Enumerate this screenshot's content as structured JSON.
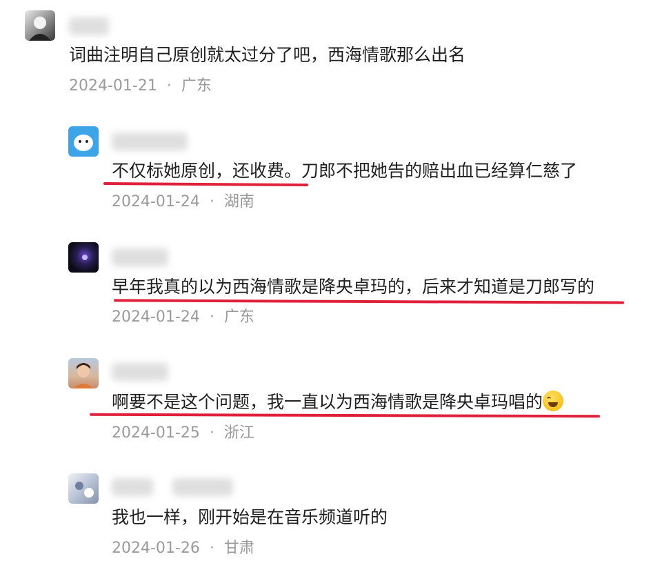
{
  "comments": [
    {
      "text": "词曲注明自己原创就太过分了吧，西海情歌那么出名",
      "date": "2024-01-21",
      "location": "广东"
    },
    {
      "text_a": "不仅标她原创，还收费。",
      "text_b": "刀郎不把她告的赔出血已经算仁慈了",
      "date": "2024-01-24",
      "location": "湖南"
    },
    {
      "text": "早年我真的以为西海情歌是降央卓玛的，后来才知道是刀郎写的",
      "date": "2024-01-24",
      "location": "广东"
    },
    {
      "text": "啊要不是这个问题，我一直以为西海情歌是降央卓玛唱的",
      "emoji": "rolling-on-floor-laughing-icon",
      "date": "2024-01-25",
      "location": "浙江"
    },
    {
      "text": "我也一样，刚开始是在音乐频道听的",
      "date": "2024-01-26",
      "location": "甘肃"
    }
  ],
  "separator": "·",
  "colors": {
    "underline": "#e0203a",
    "meta": "#9a9a9a"
  }
}
